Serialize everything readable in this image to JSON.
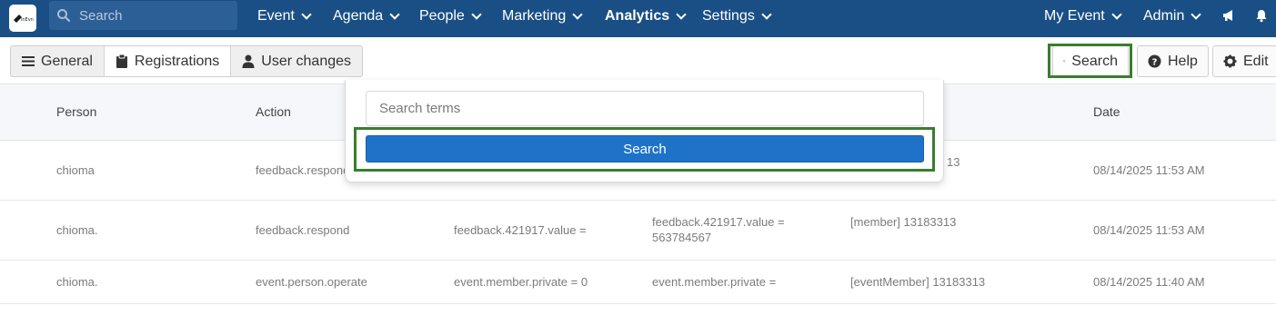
{
  "topbar": {
    "search_placeholder": "Search",
    "nav": [
      {
        "label": "Event"
      },
      {
        "label": "Agenda"
      },
      {
        "label": "People"
      },
      {
        "label": "Marketing"
      },
      {
        "label": "Analytics"
      },
      {
        "label": "Settings"
      }
    ],
    "right": [
      {
        "label": "My Event"
      },
      {
        "label": "Admin"
      }
    ],
    "icons": [
      "megaphone-icon",
      "bell-icon"
    ]
  },
  "toolbar": {
    "tabs": [
      {
        "label": "General",
        "icon": "bars-icon"
      },
      {
        "label": "Registrations",
        "icon": "clipboard-icon"
      },
      {
        "label": "User changes",
        "icon": "user-icon"
      }
    ],
    "search_label": "Search",
    "help_label": "Help",
    "edit_label": "Edit"
  },
  "table": {
    "headers": {
      "person": "Person",
      "action": "Action",
      "date": "Date"
    },
    "rows": [
      {
        "person": "chioma",
        "action": "feedback.respond",
        "old": "",
        "new": "",
        "target": "13",
        "date": "08/14/2025 11:53 AM"
      },
      {
        "person": "chioma.",
        "action": "feedback.respond",
        "old": "feedback.421917.value =",
        "new": "feedback.421917.value = 563784567",
        "target": "[member] 13183313",
        "date": "08/14/2025 11:53 AM"
      },
      {
        "person": "chioma.",
        "action": "event.person.operate",
        "old": "event.member.private = 0",
        "new": "event.member.private =",
        "target": "[eventMember] 13183313",
        "date": "08/14/2025 11:40 AM"
      }
    ]
  },
  "popover": {
    "input_placeholder": "Search terms",
    "button_label": "Search"
  },
  "colors": {
    "topbar": "#1a4f86",
    "primary_button": "#1e73c9",
    "highlight": "#3a7d2e"
  }
}
